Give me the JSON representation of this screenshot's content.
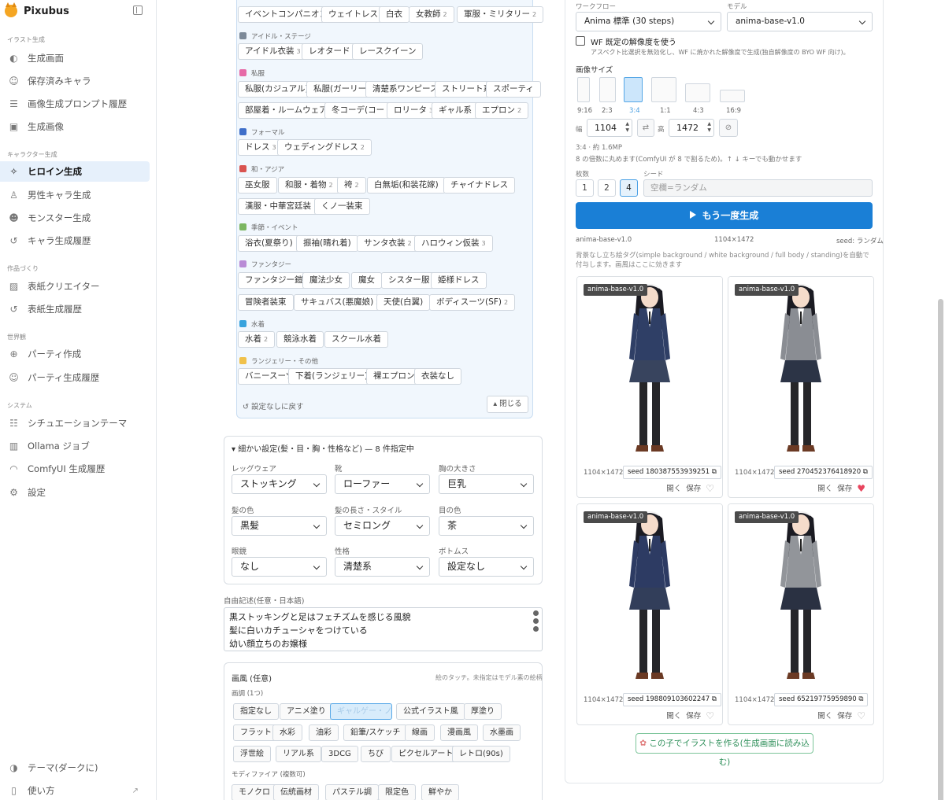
{
  "app": {
    "name": "Pixubus"
  },
  "sidebar": {
    "sections": [
      {
        "label": "イラスト生成"
      },
      {
        "label": "キャラクター生成"
      },
      {
        "label": "作品づくり"
      },
      {
        "label": "世界観"
      },
      {
        "label": "システム"
      }
    ],
    "items": [
      {
        "label": "生成画面",
        "icon": "palette-icon"
      },
      {
        "label": "保存済みキャラ",
        "icon": "users-icon"
      },
      {
        "label": "画像生成プロンプト履歴",
        "icon": "history-list-icon"
      },
      {
        "label": "生成画像",
        "icon": "images-icon"
      },
      {
        "label": "ヒロイン生成",
        "icon": "sparkle-icon"
      },
      {
        "label": "男性キャラ生成",
        "icon": "user-icon"
      },
      {
        "label": "モンスター生成",
        "icon": "monster-icon"
      },
      {
        "label": "キャラ生成履歴",
        "icon": "history-icon"
      },
      {
        "label": "表紙クリエイター",
        "icon": "image-icon"
      },
      {
        "label": "表紙生成履歴",
        "icon": "history-icon"
      },
      {
        "label": "パーティ作成",
        "icon": "globe-icon"
      },
      {
        "label": "パーティ生成履歴",
        "icon": "users-icon"
      },
      {
        "label": "シチュエーションテーマ",
        "icon": "list-icon"
      },
      {
        "label": "Ollama ジョブ",
        "icon": "bar-chart-icon"
      },
      {
        "label": "ComfyUI 生成履歴",
        "icon": "gauge-icon"
      },
      {
        "label": "設定",
        "icon": "gear-icon"
      },
      {
        "label": "テーマ(ダークに)",
        "icon": "theme-icon"
      },
      {
        "label": "使い方",
        "icon": "book-icon"
      }
    ]
  },
  "outfit": {
    "categories": [
      {
        "label": "アイドル・ステージ",
        "color": "#7d8a99"
      },
      {
        "label": "私服",
        "color": "#e66aa7"
      },
      {
        "label": "フォーマル",
        "color": "#3f6fc9"
      },
      {
        "label": "和・アジア",
        "color": "#d9534f"
      },
      {
        "label": "季節・イベント",
        "color": "#7bb661"
      },
      {
        "label": "ファンタジー",
        "color": "#b98bd6"
      },
      {
        "label": "水着",
        "color": "#38a3dd"
      },
      {
        "label": "ランジェリー・その他",
        "color": "#f0c14b"
      }
    ],
    "chips": [
      {
        "label": "イベントコンパニオン",
        "count": "2"
      },
      {
        "label": "ウェイトレス",
        "count": "2"
      },
      {
        "label": "白衣",
        "count": ""
      },
      {
        "label": "女教師",
        "count": "2"
      },
      {
        "label": "軍服・ミリタリー",
        "count": "2"
      },
      {
        "label": "アイドル衣装",
        "count": "3"
      },
      {
        "label": "レオタード",
        "count": "3"
      },
      {
        "label": "レースクイーン",
        "count": ""
      },
      {
        "label": "私服(カジュアル)",
        "count": ""
      },
      {
        "label": "私服(ガーリー)",
        "count": ""
      },
      {
        "label": "清楚系ワンピース",
        "count": ""
      },
      {
        "label": "ストリート系",
        "count": ""
      },
      {
        "label": "スポーティ",
        "count": ""
      },
      {
        "label": "部屋着・ルームウェア",
        "count": "3"
      },
      {
        "label": "冬コーデ(コート)",
        "count": ""
      },
      {
        "label": "ロリータ",
        "count": "3"
      },
      {
        "label": "ギャル系",
        "count": ""
      },
      {
        "label": "エプロン",
        "count": "2"
      },
      {
        "label": "ドレス",
        "count": "3"
      },
      {
        "label": "ウェディングドレス",
        "count": "2"
      },
      {
        "label": "巫女服",
        "count": ""
      },
      {
        "label": "和服・着物",
        "count": "2"
      },
      {
        "label": "袴",
        "count": "2"
      },
      {
        "label": "白無垢(和装花嫁)",
        "count": ""
      },
      {
        "label": "チャイナドレス",
        "count": ""
      },
      {
        "label": "漢服・中華宮廷装",
        "count": ""
      },
      {
        "label": "くノ一装束",
        "count": ""
      },
      {
        "label": "浴衣(夏祭り)",
        "count": ""
      },
      {
        "label": "振袖(晴れ着)",
        "count": ""
      },
      {
        "label": "サンタ衣装",
        "count": "2"
      },
      {
        "label": "ハロウィン仮装",
        "count": "3"
      },
      {
        "label": "ファンタジー鎧",
        "count": "3"
      },
      {
        "label": "魔法少女",
        "count": ""
      },
      {
        "label": "魔女",
        "count": ""
      },
      {
        "label": "シスター服",
        "count": ""
      },
      {
        "label": "姫様ドレス",
        "count": ""
      },
      {
        "label": "冒険者装束",
        "count": ""
      },
      {
        "label": "サキュバス(悪魔娘)",
        "count": "2"
      },
      {
        "label": "天使(白翼)",
        "count": ""
      },
      {
        "label": "ボディスーツ(SF)",
        "count": "2"
      },
      {
        "label": "水着",
        "count": "2"
      },
      {
        "label": "競泳水着",
        "count": ""
      },
      {
        "label": "スクール水着",
        "count": ""
      },
      {
        "label": "バニースーツ",
        "count": ""
      },
      {
        "label": "下着(ランジェリー)",
        "count": "4"
      },
      {
        "label": "裸エプロン",
        "count": ""
      },
      {
        "label": "衣装なし",
        "count": ""
      }
    ],
    "reset_label": "設定なしに戻す",
    "close_label": "閉じる"
  },
  "detail": {
    "title": "細かい設定(髪・目・胸・性格など) — 8 件指定中",
    "fields": [
      {
        "label": "レッグウェア",
        "value": "ストッキング"
      },
      {
        "label": "靴",
        "value": "ローファー"
      },
      {
        "label": "胸の大きさ",
        "value": "巨乳"
      },
      {
        "label": "髪の色",
        "value": "黒髪"
      },
      {
        "label": "髪の長さ・スタイル",
        "value": "セミロング"
      },
      {
        "label": "目の色",
        "value": "茶"
      },
      {
        "label": "眼鏡",
        "value": "なし"
      },
      {
        "label": "性格",
        "value": "清楚系"
      },
      {
        "label": "ボトムス",
        "value": "設定なし"
      }
    ]
  },
  "free": {
    "label": "自由記述(任意・日本語)",
    "lines": [
      "黒ストッキングと足はフェチズムを感じる風貌",
      "髪に白いカチューシャをつけている",
      "幼い顔立ちのお嬢様"
    ]
  },
  "style": {
    "title": "画風 (任意)",
    "hint": "絵のタッチ。未指定はモデル素の絵柄",
    "tone_label": "画調 (1つ)",
    "modifier_label": "モディファイア (複数可)",
    "chips": [
      "指定なし",
      "アニメ塗り",
      "ギャルゲー・ノベル",
      "公式イラスト風",
      "厚塗り",
      "フラット",
      "水彩",
      "油彩",
      "鉛筆/スケッチ",
      "線画",
      "漫画風",
      "水墨画",
      "浮世絵",
      "リアル系",
      "3DCG",
      "ちび",
      "ピクセルアート",
      "レトロ(90s)"
    ],
    "modifiers": [
      "モノクロ",
      "伝統画材",
      "パステル調",
      "限定色",
      "鮮やか"
    ]
  },
  "right": {
    "workflow_label": "ワークフロー",
    "workflow_value": "Anima 標準 (30 steps)",
    "model_label": "モデル",
    "model_value": "anima-base-v1.0",
    "wf_check_label": "WF 既定の解像度を使う",
    "wf_check_desc": "アスペクト比選択を無効化し、WF に焼かれた解像度で生成(独自解像度の BYO WF 向け)。",
    "size_label": "画像サイズ",
    "ratios": [
      "9:16",
      "2:3",
      "3:4",
      "1:1",
      "4:3",
      "16:9"
    ],
    "selected_ratio": "3:4",
    "width_label": "幅",
    "width_value": "1104",
    "height_label": "高",
    "height_value": "1472",
    "size_info": "3:4 · 約 1.6MP",
    "size_hint": "8 の倍数に丸めます(ComfyUI が 8 で割るため)。↑ ↓ キーでも動かせます",
    "count_label": "枚数",
    "counts": [
      "1",
      "2",
      "4"
    ],
    "selected_count": "4",
    "seed_label": "シード",
    "seed_placeholder": "空欄=ランダム",
    "generate_label": "もう一度生成",
    "meta_model": "anima-base-v1.0",
    "meta_size": "1104×1472",
    "meta_seed": "seed: ランダム",
    "note": "背景なし立ち絵タグ(simple background / white background / full body / standing)を自動で付与します。画風はここに効きます",
    "make_label": "この子でイラストを作る(生成画面に読み込む)"
  },
  "cards": [
    {
      "badge": "anima-base-v1.0",
      "size": "1104×1472",
      "seed": "seed 180387553939251",
      "open": "開く",
      "save": "保存",
      "fav": false,
      "jacket": "#2f3f66",
      "skirt": "#38445e"
    },
    {
      "badge": "anima-base-v1.0",
      "size": "1104×1472",
      "seed": "seed 270452376418920",
      "open": "開く",
      "save": "保存",
      "fav": true,
      "jacket": "#8a8d93",
      "skirt": "#2c3446"
    },
    {
      "badge": "anima-base-v1.0",
      "size": "1104×1472",
      "seed": "seed 198809103602247",
      "open": "開く",
      "save": "保存",
      "fav": false,
      "jacket": "#2d3b63",
      "skirt": "#323e5a"
    },
    {
      "badge": "anima-base-v1.0",
      "size": "1104×1472",
      "seed": "seed 65219775959890",
      "open": "開く",
      "save": "保存",
      "fav": false,
      "jacket": "#92959a",
      "skirt": "#2a3142"
    }
  ]
}
